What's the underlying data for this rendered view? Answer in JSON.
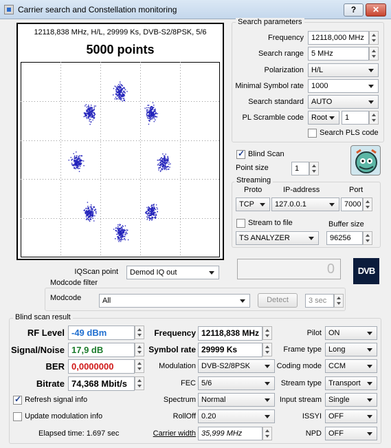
{
  "window": {
    "title": "Carrier search and Constellation monitoring",
    "help_label": "?",
    "close_label": "✕"
  },
  "constellation": {
    "header": "12118,838 MHz, H/L, 29999 Ks, DVB-S2/8PSK, 5/6",
    "points_label": "5000 points",
    "point_color": "#2222bb",
    "clusters": [
      {
        "i": 0.0,
        "q": 1.0
      },
      {
        "i": 0.71,
        "q": 0.71
      },
      {
        "i": 1.0,
        "q": 0.0
      },
      {
        "i": 0.71,
        "q": -0.71
      },
      {
        "i": 0.0,
        "q": -1.0
      },
      {
        "i": -0.71,
        "q": -0.71
      },
      {
        "i": -1.0,
        "q": 0.0
      },
      {
        "i": -0.71,
        "q": 0.71
      }
    ]
  },
  "iqscan": {
    "label": "IQScan point",
    "value": "Demod IQ out"
  },
  "counter": {
    "value": "0"
  },
  "dvb_logo": "DVB",
  "modcode": {
    "group_label": "Modcode filter",
    "label": "Modcode",
    "value": "All",
    "detect_label": "Detect",
    "interval": "3 sec"
  },
  "search": {
    "group_label": "Search parameters",
    "frequency_label": "Frequency",
    "frequency": "12118,000 MHz",
    "range_label": "Search range",
    "range": "5 MHz",
    "polarization_label": "Polarization",
    "polarization": "H/L",
    "min_sr_label": "Minimal Symbol rate",
    "min_sr": "1000",
    "standard_label": "Search standard",
    "standard": "AUTO",
    "pls_label": "PL Scramble code",
    "pls_mode": "Root",
    "pls_value": "1",
    "search_pls_label": "Search PLS code"
  },
  "blind": {
    "label": "Blind Scan",
    "checked": true,
    "point_size_label": "Point size",
    "point_size": "1"
  },
  "streaming": {
    "group_label": "Streaming",
    "proto_label": "Proto",
    "proto": "TCP",
    "ip_label": "IP-address",
    "ip": "127.0.0.1",
    "port_label": "Port",
    "port": "7000",
    "stream_file_label": "Stream to file",
    "buffer_label": "Buffer size",
    "buffer": "96256",
    "analyzer": "TS ANALYZER"
  },
  "result": {
    "group_label": "Blind scan result",
    "rf_label": "RF Level",
    "rf": "-49 dBm",
    "snr_label": "Signal/Noise",
    "snr": "17,9 dB",
    "ber_label": "BER",
    "ber": "0,0000000",
    "bitrate_label": "Bitrate",
    "bitrate": "74,368 Mbit/s",
    "refresh_label": "Refresh signal info",
    "update_mod_label": "Update modulation info",
    "elapsed": "Elapsed time: 1.697 sec",
    "freq_label": "Frequency",
    "freq": "12118,838 MHz",
    "sr_label": "Symbol rate",
    "sr": "29999 Ks",
    "modulation_label": "Modulation",
    "modulation": "DVB-S2/8PSK",
    "fec_label": "FEC",
    "fec": "5/6",
    "spectrum_label": "Spectrum",
    "spectrum": "Normal",
    "rolloff_label": "RollOff",
    "rolloff": "0.20",
    "carrier_width_label": "Carrier width",
    "carrier_width": "35,999 MHz",
    "pilot_label": "Pilot",
    "pilot": "ON",
    "frame_label": "Frame type",
    "frame": "Long",
    "coding_label": "Coding mode",
    "coding": "CCM",
    "stream_type_label": "Stream type",
    "stream_type": "Transport",
    "input_stream_label": "Input stream",
    "input_stream": "Single",
    "issyi_label": "ISSYI",
    "issyi": "OFF",
    "npd_label": "NPD",
    "npd": "OFF"
  }
}
